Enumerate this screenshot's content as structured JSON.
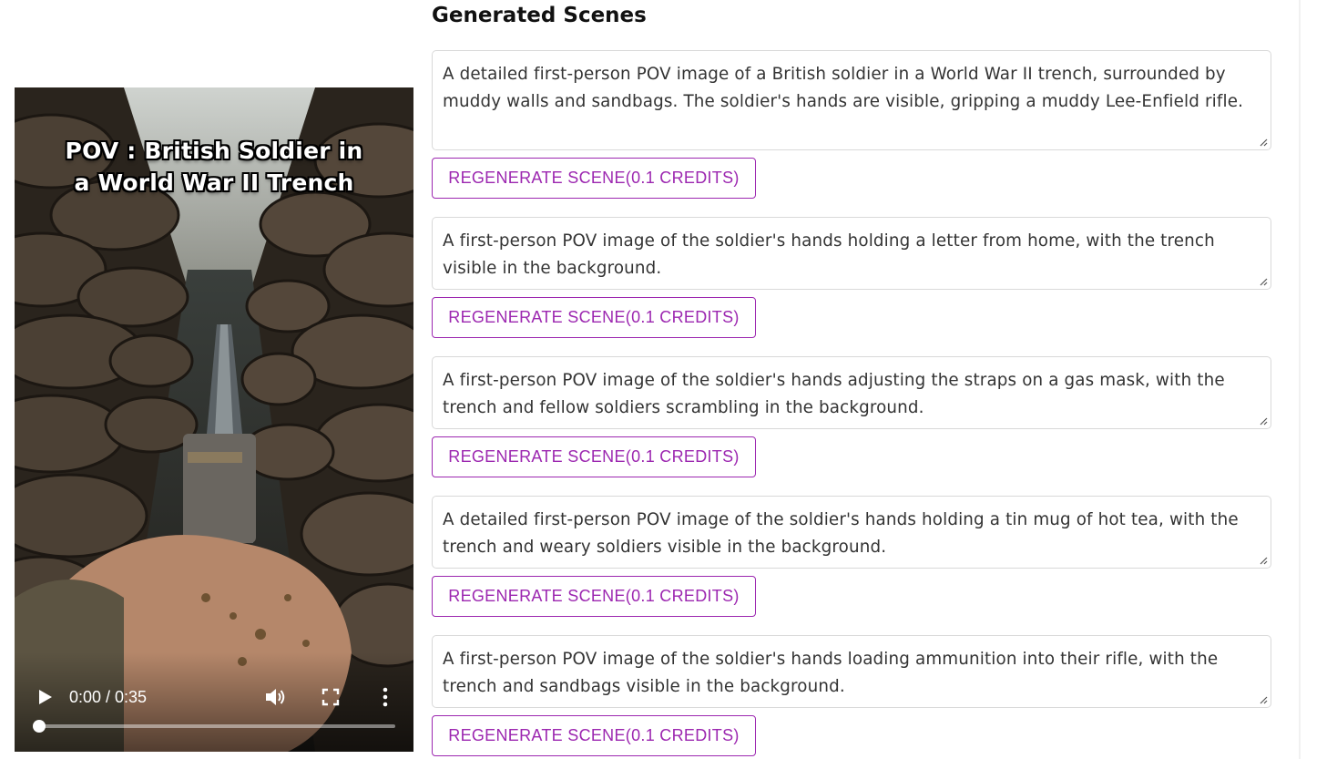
{
  "video": {
    "overlay_title_line1": "POV : British Soldier in",
    "overlay_title_line2": "a World War II Trench",
    "time_display": "0:00 / 0:35",
    "progress": 0,
    "icons": {
      "play": "play-icon",
      "volume": "volume-icon",
      "fullscreen": "fullscreen-icon",
      "more": "more-options-icon"
    }
  },
  "panel": {
    "title": "Generated Scenes"
  },
  "scenes": [
    {
      "text": "A detailed first-person POV image of a British soldier in a World War II trench, surrounded by muddy walls and sandbags. The soldier's hands are visible, gripping a muddy Lee-Enfield rifle.",
      "button_label": "REGENERATE SCENE(0.1 CREDITS)"
    },
    {
      "text": "A first-person POV image of the soldier's hands holding a letter from home, with the trench visible in the background.",
      "button_label": "REGENERATE SCENE(0.1 CREDITS)"
    },
    {
      "text": "A first-person POV image of the soldier's hands adjusting the straps on a gas mask, with the trench and fellow soldiers scrambling in the background.",
      "button_label": "REGENERATE SCENE(0.1 CREDITS)"
    },
    {
      "text": "A detailed first-person POV image of the soldier's hands holding a tin mug of hot tea, with the trench and weary soldiers visible in the background.",
      "button_label": "REGENERATE SCENE(0.1 CREDITS)"
    },
    {
      "text": "A first-person POV image of the soldier's hands loading ammunition into their rifle, with the trench and sandbags visible in the background.",
      "button_label": "REGENERATE SCENE(0.1 CREDITS)"
    }
  ],
  "colors": {
    "accent": "#9c27b0",
    "border": "#d9d9d9",
    "text": "#333333"
  }
}
